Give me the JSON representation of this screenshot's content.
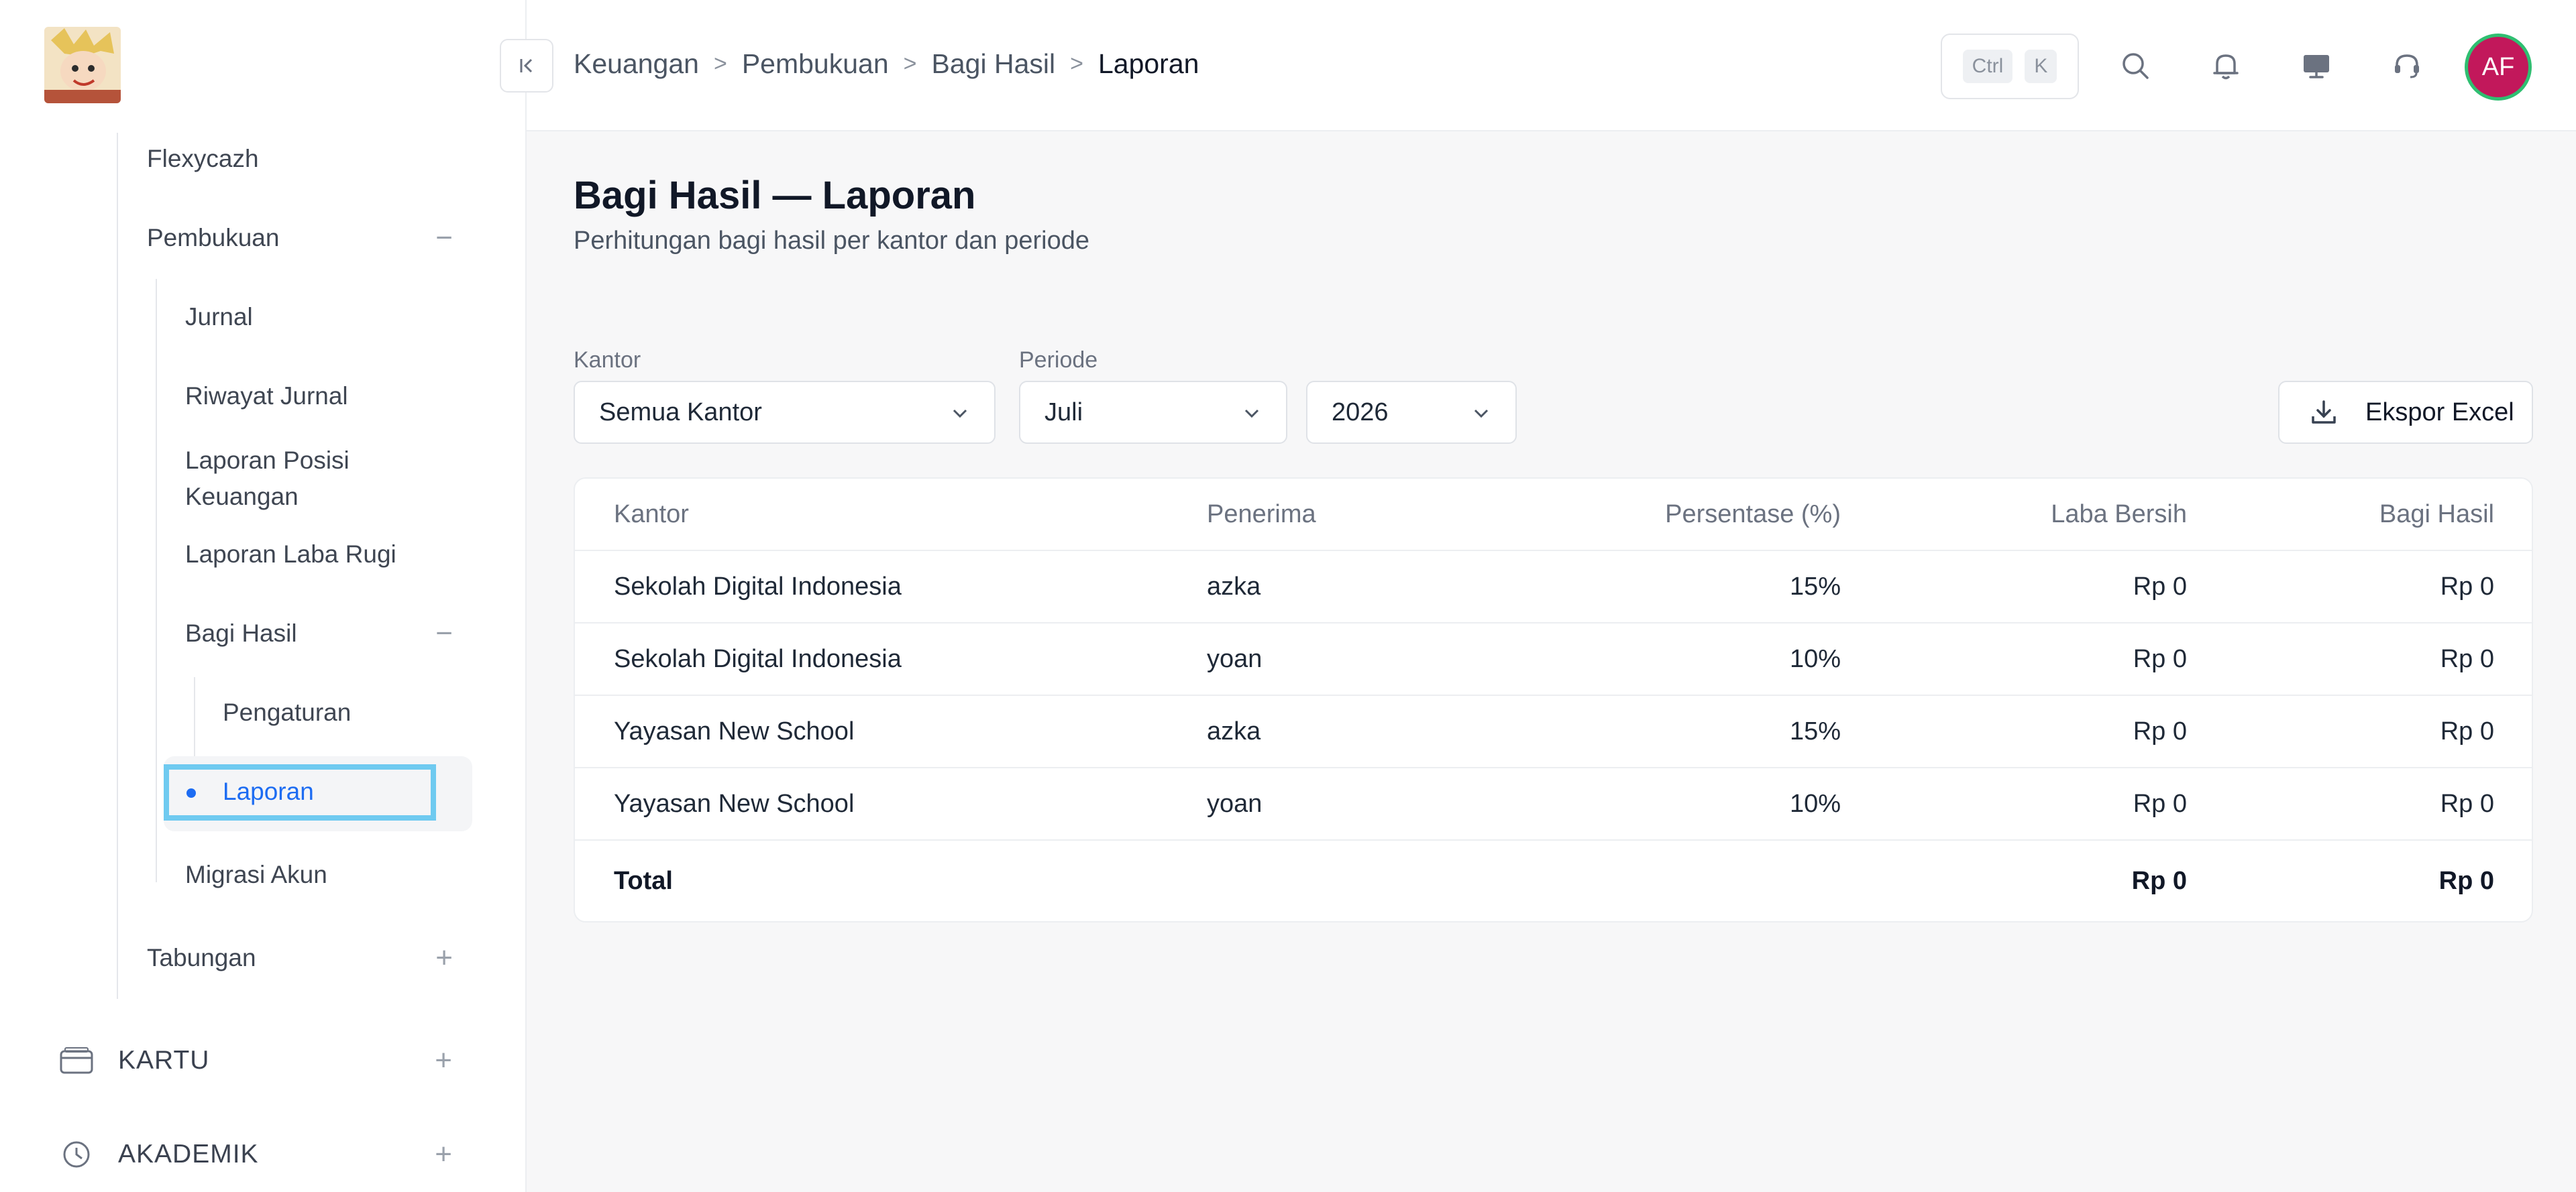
{
  "sidebar": {
    "items": [
      {
        "label": "Flexycazh"
      },
      {
        "label": "Pembukuan",
        "toggle": "−"
      },
      {
        "label": "Jurnal"
      },
      {
        "label": "Riwayat Jurnal"
      },
      {
        "label": "Laporan Posisi Keuangan"
      },
      {
        "label": "Laporan Laba Rugi"
      },
      {
        "label": "Bagi Hasil",
        "toggle": "−"
      },
      {
        "label": "Pengaturan"
      },
      {
        "label": "Laporan",
        "active": true
      },
      {
        "label": "Migrasi Akun"
      },
      {
        "label": "Tabungan",
        "toggle": "+"
      }
    ],
    "sections": [
      {
        "label": "KARTU",
        "icon": "card-icon",
        "toggle": "+"
      },
      {
        "label": "AKADEMIK",
        "icon": "academic-icon",
        "toggle": "+"
      }
    ]
  },
  "topbar": {
    "breadcrumb": [
      "Keuangan",
      "Pembukuan",
      "Bagi Hasil",
      "Laporan"
    ],
    "shortcut_keys": [
      "Ctrl",
      "K"
    ],
    "icons": [
      "search-icon",
      "bell-icon",
      "monitor-icon",
      "headset-icon"
    ],
    "avatar_initials": "AF"
  },
  "page": {
    "title": "Bagi Hasil — Laporan",
    "subtitle": "Perhitungan bagi hasil per kantor dan periode"
  },
  "filters": {
    "kantor_label": "Kantor",
    "kantor_value": "Semua Kantor",
    "periode_label": "Periode",
    "month_value": "Juli",
    "year_value": "2026",
    "export_label": "Ekspor Excel"
  },
  "table": {
    "headers": [
      "Kantor",
      "Penerima",
      "Persentase (%)",
      "Laba Bersih",
      "Bagi Hasil"
    ],
    "rows": [
      [
        "Sekolah Digital Indonesia",
        "azka",
        "15%",
        "Rp 0",
        "Rp 0"
      ],
      [
        "Sekolah Digital Indonesia",
        "yoan",
        "10%",
        "Rp 0",
        "Rp 0"
      ],
      [
        "Yayasan New School",
        "azka",
        "15%",
        "Rp 0",
        "Rp 0"
      ],
      [
        "Yayasan New School",
        "yoan",
        "10%",
        "Rp 0",
        "Rp 0"
      ]
    ],
    "total": {
      "label": "Total",
      "laba_bersih": "Rp 0",
      "bagi_hasil": "Rp 0"
    }
  },
  "colors": {
    "accent": "#1d6cf2",
    "avatar_bg": "#c2185b",
    "avatar_ring": "#2fbf71",
    "highlight_box": "#6fcaf0"
  }
}
